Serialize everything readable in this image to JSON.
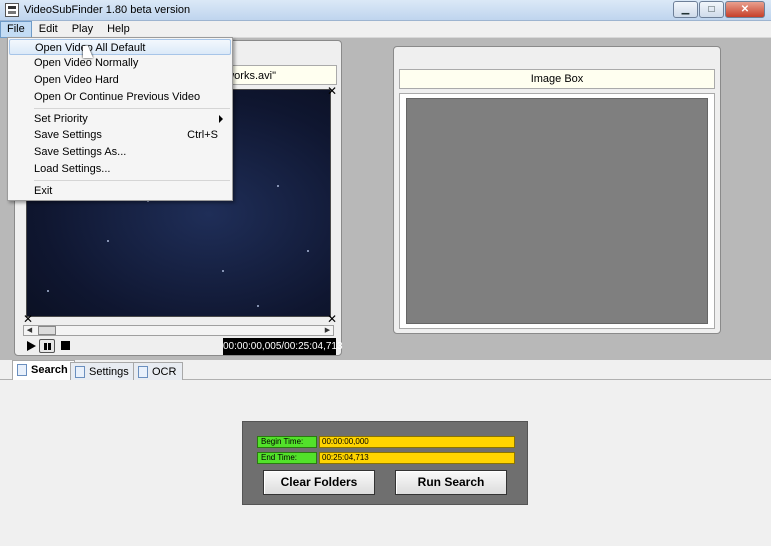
{
  "window": {
    "title": "VideoSubFinder 1.80 beta version",
    "minimize": "▁",
    "maximize": "□",
    "close": "✕"
  },
  "menubar": {
    "items": [
      "File",
      "Edit",
      "Play",
      "Help"
    ]
  },
  "file_menu": {
    "items": [
      {
        "label": "Open Video All Default"
      },
      {
        "label": "Open Video Normally"
      },
      {
        "label": "Open Video Hard"
      },
      {
        "label": "Open Or Continue Previous Video"
      },
      {
        "label": "Set Priority",
        "has_submenu": true
      },
      {
        "label": "Save Settings",
        "shortcut": "Ctrl+S"
      },
      {
        "label": "Save Settings As..."
      },
      {
        "label": "Load Settings..."
      },
      {
        "label": "Exit"
      }
    ]
  },
  "video_box": {
    "title_visible": "eworks.avi\"",
    "time": "00:00:00,005/00:25:04,713"
  },
  "image_box": {
    "title": "Image Box"
  },
  "tabs": [
    {
      "label": "Search"
    },
    {
      "label": "Settings"
    },
    {
      "label": "OCR"
    }
  ],
  "search": {
    "begin_label": "Begin Time:",
    "begin_value": "00:00:00,000",
    "end_label": "End Time:",
    "end_value": "00:25:04,713",
    "clear_button": "Clear Folders",
    "run_button": "Run Search"
  },
  "colors": {
    "field_label_bg": "#52e12a",
    "field_value_bg": "#ffd400",
    "search_panel_bg": "#6f6f6f"
  }
}
